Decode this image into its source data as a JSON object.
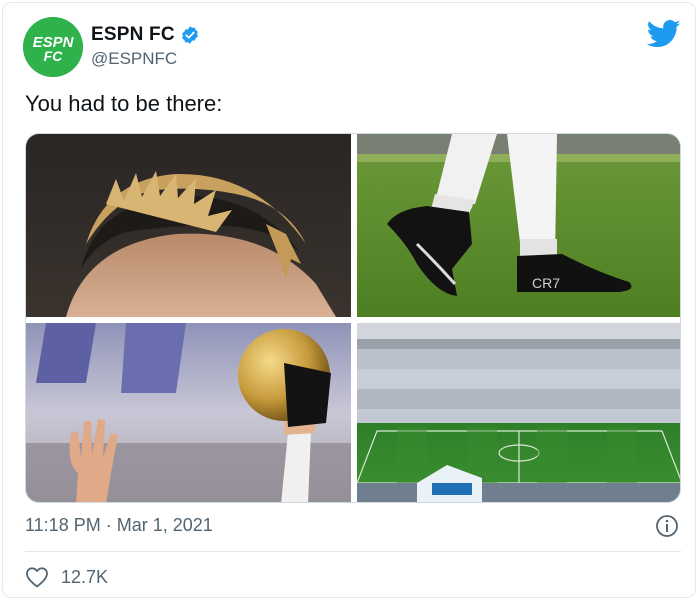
{
  "account": {
    "display_name": "ESPN FC",
    "handle": "@ESPNFC",
    "avatar_text_top": "ESPN",
    "avatar_text_bottom": "FC"
  },
  "tweet": {
    "text": "You had to be there:",
    "time": "11:18 PM",
    "separator": "·",
    "date": "Mar 1, 2021",
    "likes": "12.7K"
  },
  "media": [
    {
      "alt": "close-up of blond hair"
    },
    {
      "alt": "football boots on grass"
    },
    {
      "alt": "hand holding golden ball trophy"
    },
    {
      "alt": "packed football stadium"
    }
  ],
  "boot_text": "CR7",
  "colors": {
    "brand_green": "#2fb14c",
    "twitter_blue": "#1d9bf0",
    "secondary_text": "#536471"
  },
  "icons": [
    "verified-badge-icon",
    "twitter-bird-icon",
    "info-icon",
    "heart-icon"
  ]
}
